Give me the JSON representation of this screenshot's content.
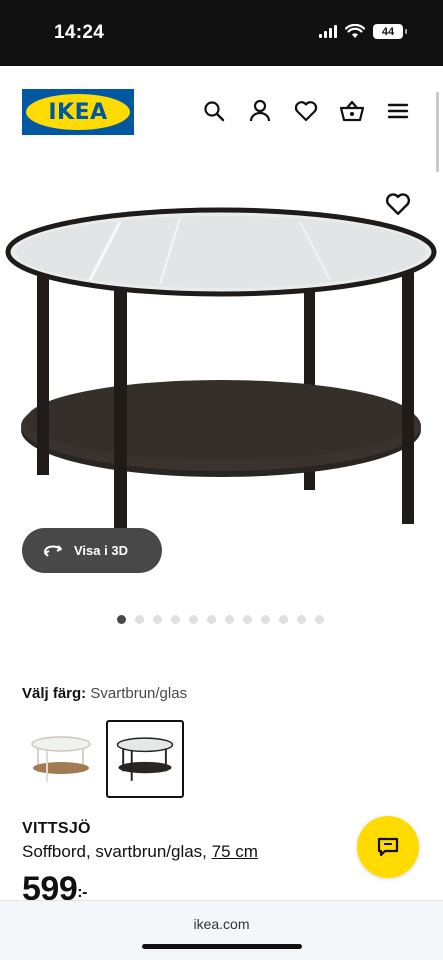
{
  "status_bar": {
    "time": "14:24",
    "battery": "44",
    "icons": [
      "signal-icon",
      "wifi-icon",
      "battery-icon"
    ]
  },
  "header": {
    "logo_text": "IKEA",
    "icons": [
      "search-icon",
      "account-icon",
      "favorites-icon",
      "cart-icon",
      "menu-icon"
    ]
  },
  "gallery": {
    "view_3d_label": "Visa i 3D",
    "image_count": 12,
    "active_index": 0
  },
  "color_selector": {
    "label": "Välj färg:",
    "value": "Svartbrun/glas",
    "options": [
      {
        "name": "white-oak",
        "selected": false
      },
      {
        "name": "black-brown",
        "selected": true
      }
    ]
  },
  "product": {
    "name": "VITTSJÖ",
    "description": "Soffbord, svartbrun/glas, ",
    "size_link": "75 cm",
    "price": "599",
    "price_suffix": ":-"
  },
  "browser": {
    "url": "ikea.com"
  },
  "colors": {
    "ikea_blue": "#0058a3",
    "ikea_yellow": "#ffdb00",
    "pill_dark": "#484848"
  }
}
